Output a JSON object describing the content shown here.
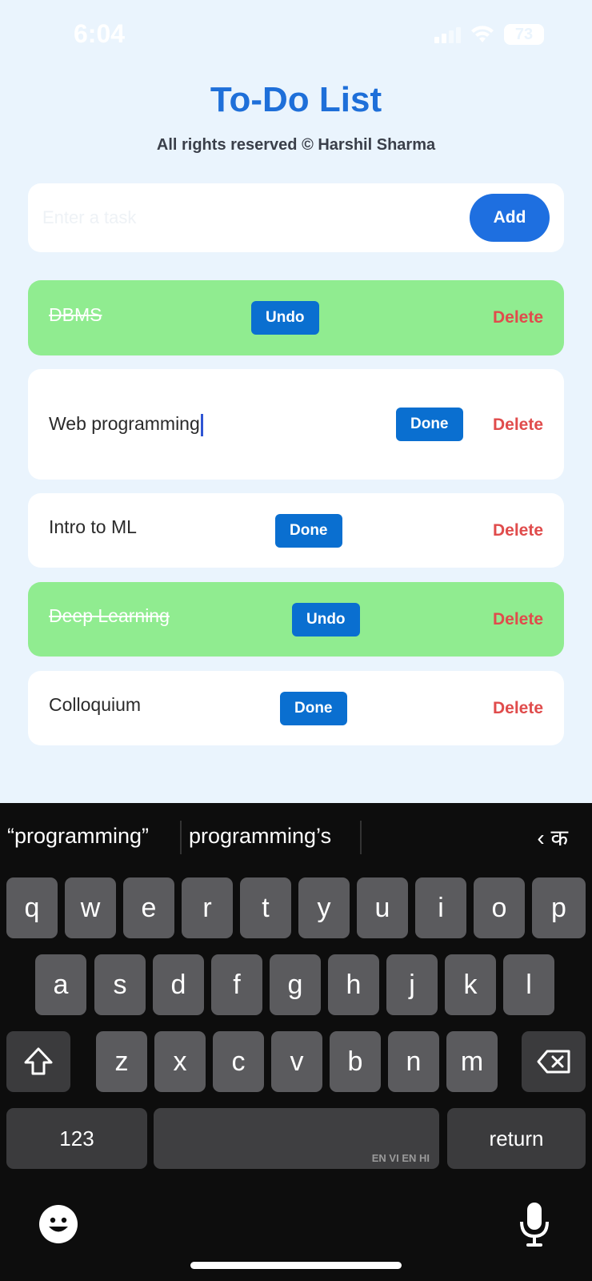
{
  "status": {
    "time": "6:04",
    "battery": "73"
  },
  "app": {
    "title": "To-Do List",
    "subtitle": "All rights reserved © Harshil Sharma",
    "input_placeholder": "Enter a task",
    "add_label": "Add"
  },
  "tasks": [
    {
      "text": "DBMS",
      "completed": true,
      "action_label": "Undo",
      "delete_label": "Delete"
    },
    {
      "text": "Web programming",
      "completed": false,
      "action_label": "Done",
      "delete_label": "Delete",
      "editing": true
    },
    {
      "text": "Intro to ML",
      "completed": false,
      "action_label": "Done",
      "delete_label": "Delete"
    },
    {
      "text": "Deep Learning",
      "completed": true,
      "action_label": "Undo",
      "delete_label": "Delete"
    },
    {
      "text": "Colloquium",
      "completed": false,
      "action_label": "Done",
      "delete_label": "Delete"
    }
  ],
  "keyboard": {
    "suggestions": [
      "“programming”",
      "programming’s"
    ],
    "language_switch": "‹ क",
    "row1": [
      "q",
      "w",
      "e",
      "r",
      "t",
      "y",
      "u",
      "i",
      "o",
      "p"
    ],
    "row2": [
      "a",
      "s",
      "d",
      "f",
      "g",
      "h",
      "j",
      "k",
      "l"
    ],
    "row3": [
      "z",
      "x",
      "c",
      "v",
      "b",
      "n",
      "m"
    ],
    "numbers_label": "123",
    "return_label": "return",
    "space_hint": "EN VI EN HI"
  },
  "colors": {
    "accent": "#1e6fd9",
    "done_bg": "#90ec90",
    "delete": "#e04c4c",
    "button": "#0a6fd0"
  }
}
